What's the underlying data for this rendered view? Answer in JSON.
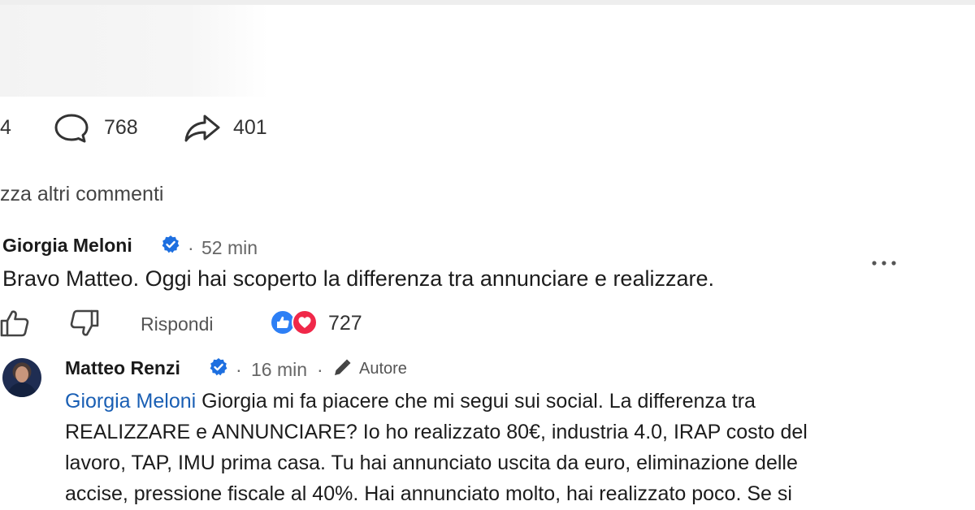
{
  "post_stats": {
    "likes_partial": "4",
    "comments_count": "768",
    "shares_count": "401"
  },
  "more_comments": {
    "label": "zza altri commenti"
  },
  "comment": {
    "author": "Giorgia Meloni",
    "separator": "·",
    "time": "52 min",
    "text": "Bravo Matteo. Oggi hai scoperto la differenza tra annunciare e realizzare.",
    "more_icon": "more-horizontal-icon",
    "reply_label": "Rispondi",
    "reactions_count": "727"
  },
  "reply": {
    "author": "Matteo Renzi",
    "separator": "·",
    "time": "16 min",
    "separator2": "·",
    "author_badge": "Autore",
    "mention": "Giorgia Meloni",
    "lines": [
      " Giorgia mi fa piacere che mi segui sui social. La differenza tra",
      "REALIZZARE e ANNUNCIARE? Io ho realizzato 80€, industria 4.0, IRAP costo del",
      "lavoro, TAP, IMU prima casa. Tu hai annunciato uscita da euro, eliminazione delle",
      "accise, pressione fiscale al 40%. Hai annunciato molto, hai realizzato poco. Se si"
    ]
  },
  "colors": {
    "verified_blue": "#1d6fe0",
    "like_blue": "#2d7ff5",
    "love_red": "#f02849",
    "mention_blue": "#1a5fb4"
  }
}
